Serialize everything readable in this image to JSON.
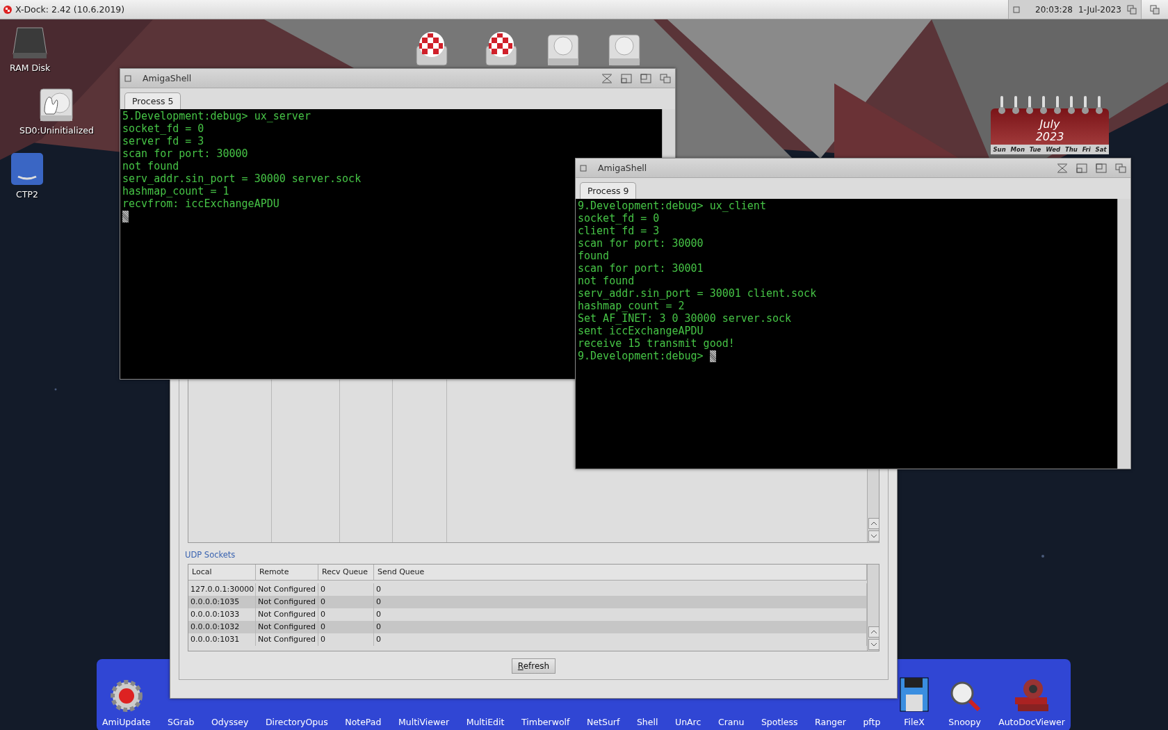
{
  "top_bar": {
    "title": "X-Dock: 2.42 (10.6.2019)",
    "time": "20:03:28",
    "date": "1-Jul-2023"
  },
  "desktop_icons": [
    {
      "label": "RAM Disk",
      "kind": "ramdisk"
    },
    {
      "label": "SD0:Uninitialized",
      "kind": "harddisk"
    },
    {
      "label": "CTP2",
      "kind": "bluedrive"
    }
  ],
  "drive_icons": [
    {
      "kind": "boing"
    },
    {
      "kind": "boing"
    },
    {
      "kind": "drive"
    },
    {
      "kind": "drive"
    }
  ],
  "calendar": {
    "month": "July",
    "year": "2023",
    "weekdays": [
      "Sun",
      "Mon",
      "Tue",
      "Wed",
      "Thu",
      "Fri",
      "Sat"
    ]
  },
  "network_window": {
    "udp_section": {
      "title": "UDP Sockets",
      "columns": [
        "Local",
        "Remote",
        "Recv Queue",
        "Send Queue"
      ],
      "rows": [
        [
          "127.0.0.1:30000",
          "Not Configured",
          "0",
          "0"
        ],
        [
          "0.0.0.0:1035",
          "Not Configured",
          "0",
          "0"
        ],
        [
          "0.0.0.0:1033",
          "Not Configured",
          "0",
          "0"
        ],
        [
          "0.0.0.0:1032",
          "Not Configured",
          "0",
          "0"
        ],
        [
          "0.0.0.0:1031",
          "Not Configured",
          "0",
          "0"
        ]
      ]
    },
    "refresh_button": "Refresh"
  },
  "shells": [
    {
      "title": "AmigaShell",
      "tab": "Process 5",
      "lines": [
        "5.Development:debug> ux_server",
        "socket_fd = 0",
        "server fd = 3",
        "scan for port: 30000",
        "not found",
        "serv_addr.sin_port = 30000 server.sock",
        "hashmap_count = 1",
        "recvfrom: iccExchangeAPDU"
      ]
    },
    {
      "title": "AmigaShell",
      "tab": "Process 9",
      "prompt": "9.Development:debug> ",
      "lines": [
        "9.Development:debug> ux_client",
        "socket_fd = 0",
        "client fd = 3",
        "scan for port: 30000",
        "found",
        "scan for port: 30001",
        "not found",
        "serv_addr.sin_port = 30001 client.sock",
        "hashmap_count = 2",
        "Set AF_INET: 3 0 30000 server.sock",
        "sent iccExchangeAPDU",
        "receive 15 transmit good!"
      ]
    }
  ],
  "dock": [
    {
      "label": "AmiUpdate",
      "kind": "gear"
    },
    {
      "label": "SGrab",
      "kind": "app"
    },
    {
      "label": "Odyssey",
      "kind": "app"
    },
    {
      "label": "DirectoryOpus",
      "kind": "app"
    },
    {
      "label": "NotePad",
      "kind": "app"
    },
    {
      "label": "MultiViewer",
      "kind": "app"
    },
    {
      "label": "MultiEdit",
      "kind": "app"
    },
    {
      "label": "Timberwolf",
      "kind": "app"
    },
    {
      "label": "NetSurf",
      "kind": "app"
    },
    {
      "label": "Shell",
      "kind": "app"
    },
    {
      "label": "UnArc",
      "kind": "app"
    },
    {
      "label": "Cranu",
      "kind": "app"
    },
    {
      "label": "Spotless",
      "kind": "app"
    },
    {
      "label": "Ranger",
      "kind": "app"
    },
    {
      "label": "pftp",
      "kind": "app"
    },
    {
      "label": "FileX",
      "kind": "floppy"
    },
    {
      "label": "Snoopy",
      "kind": "magnifier"
    },
    {
      "label": "AutoDocViewer",
      "kind": "books"
    }
  ]
}
